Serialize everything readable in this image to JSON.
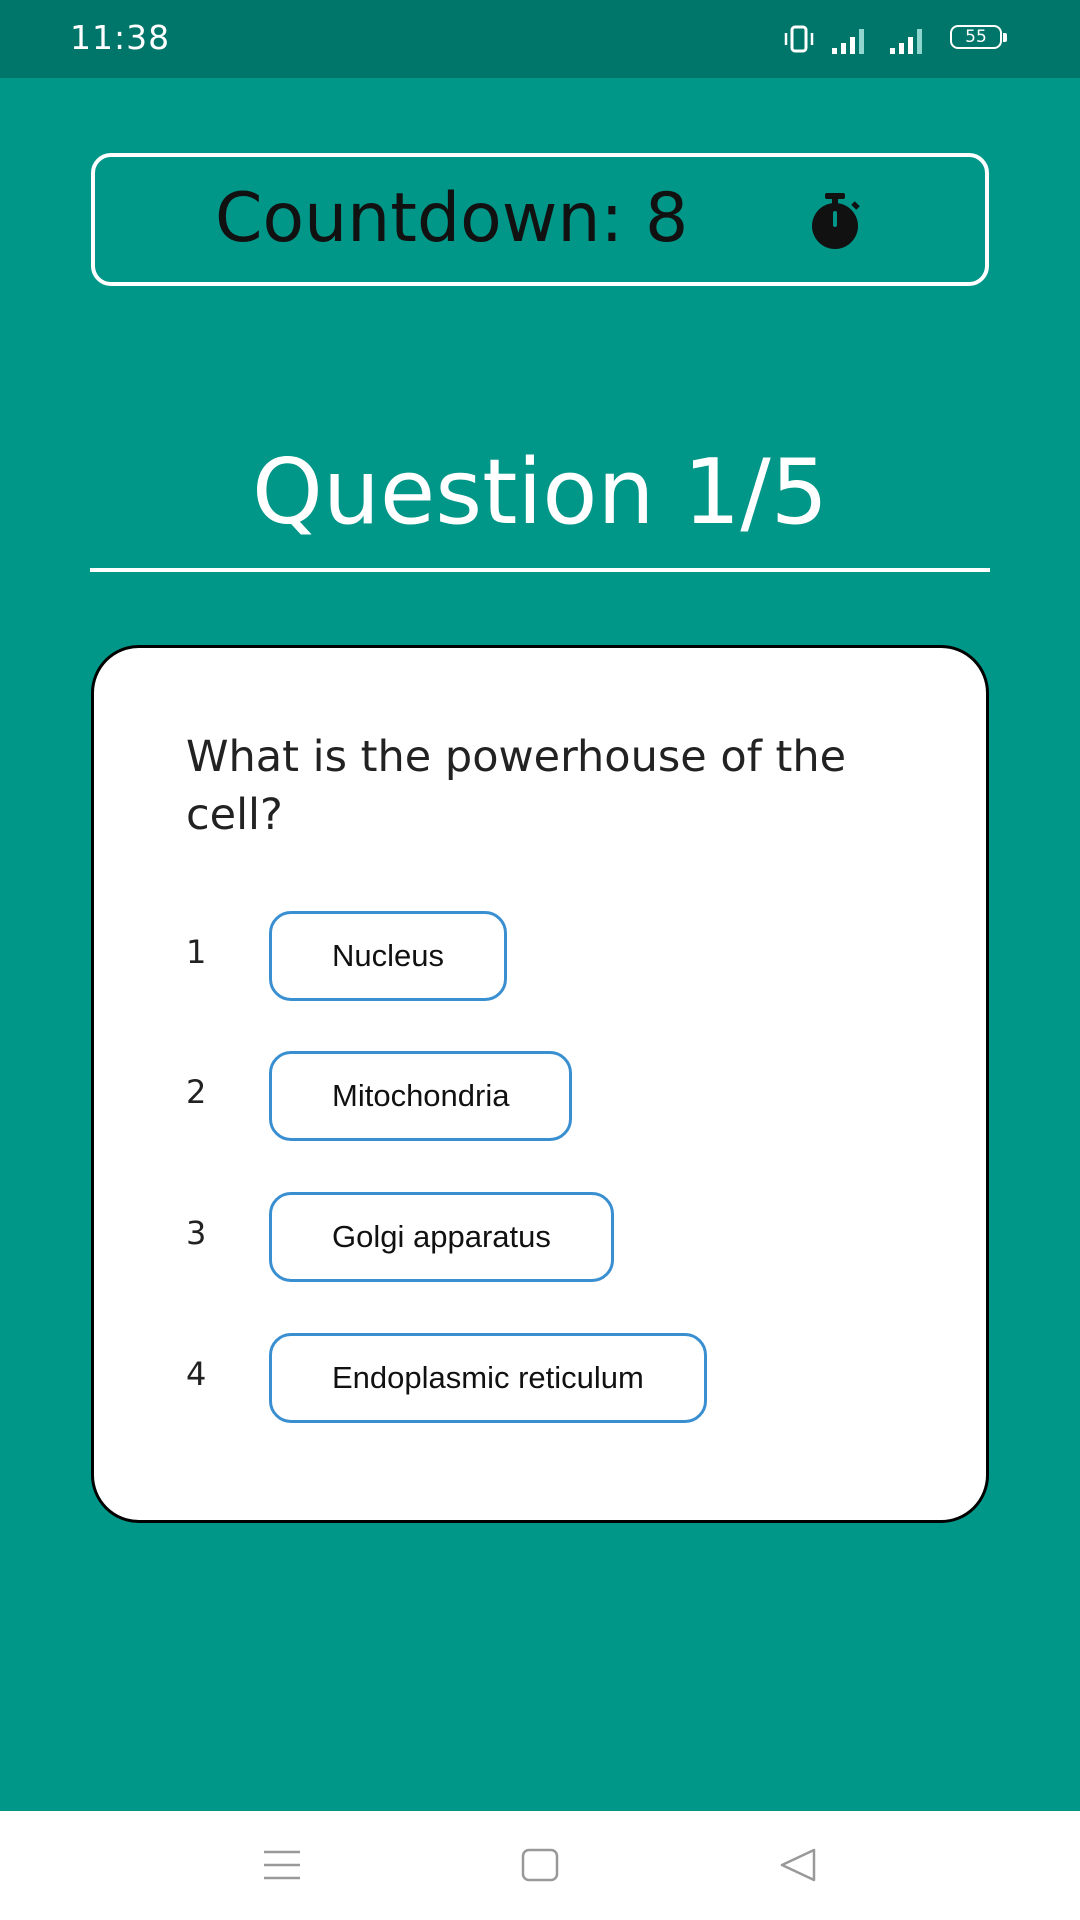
{
  "status_bar": {
    "time": "11:38",
    "battery_level": "55",
    "icons": [
      "vibrate-icon",
      "signal-icon",
      "signal-icon",
      "battery-icon"
    ]
  },
  "countdown": {
    "label": "Countdown: 8",
    "icon": "stopwatch-icon"
  },
  "question": {
    "title": "Question 1/5",
    "text": "What is the powerhouse of the cell?",
    "options": [
      {
        "number": "1",
        "label": "Nucleus"
      },
      {
        "number": "2",
        "label": "Mitochondria"
      },
      {
        "number": "3",
        "label": "Golgi apparatus"
      },
      {
        "number": "4",
        "label": "Endoplasmic reticulum"
      }
    ]
  },
  "nav_bar": {
    "icons": [
      "menu-icon",
      "home-icon",
      "back-icon"
    ]
  },
  "colors": {
    "background": "#009688",
    "status_bar": "#00756a",
    "option_border": "#3a8fd1",
    "card": "#ffffff"
  }
}
